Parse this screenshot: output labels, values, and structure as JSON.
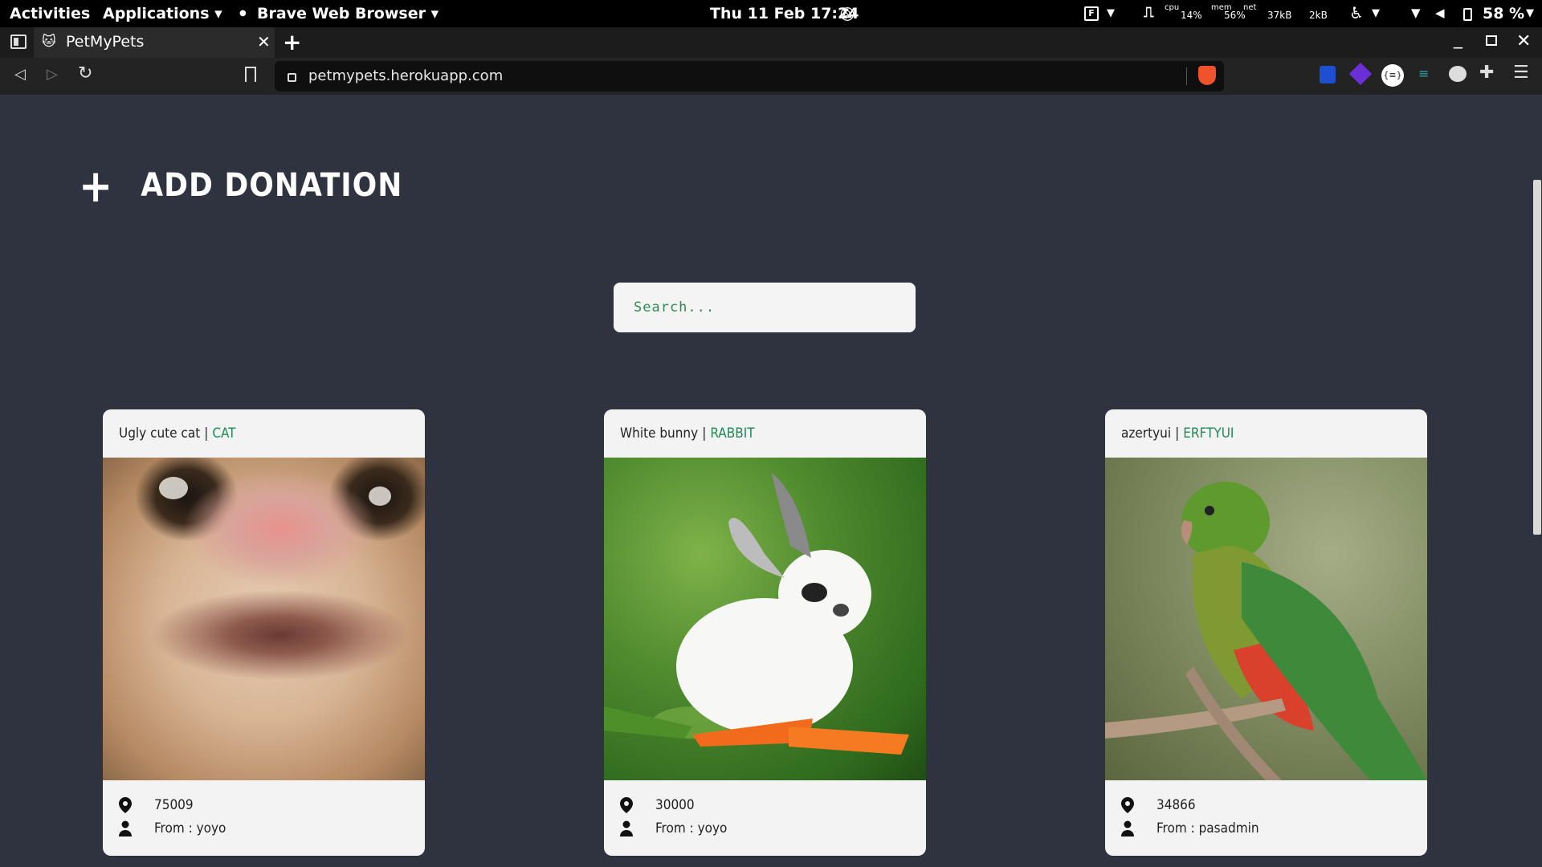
{
  "topbar": {
    "activities": "Activities",
    "applications": "Applications ▾",
    "browser_name": "Brave Web Browser ▾",
    "datetime": "Thu 11 Feb 17:24",
    "cpu_label": "cpu",
    "cpu_value": "14%",
    "mem_label": "mem",
    "mem_value": "56%",
    "net_label": "net",
    "net_down": "37kB",
    "net_up": "2kB",
    "battery": "58 %"
  },
  "tab": {
    "title": "PetMyPets"
  },
  "address": {
    "url": "petmypets.herokuapp.com"
  },
  "page": {
    "add_label": "ADD DONATION",
    "search_placeholder": "Search...",
    "cards": [
      {
        "name": "Ugly cute cat",
        "sep": "|",
        "type": "CAT",
        "location": "75009",
        "from": "From : yoyo"
      },
      {
        "name": "White bunny",
        "sep": "|",
        "type": "RABBIT",
        "location": "30000",
        "from": "From : yoyo"
      },
      {
        "name": "azertyui",
        "sep": "|",
        "type": "ERFTYUI",
        "location": "34866",
        "from": "From : pasadmin"
      }
    ]
  },
  "colors": {
    "page_bg": "#2f3340",
    "accent_green": "#1e8a58",
    "card_bg": "#f3f3f3"
  }
}
